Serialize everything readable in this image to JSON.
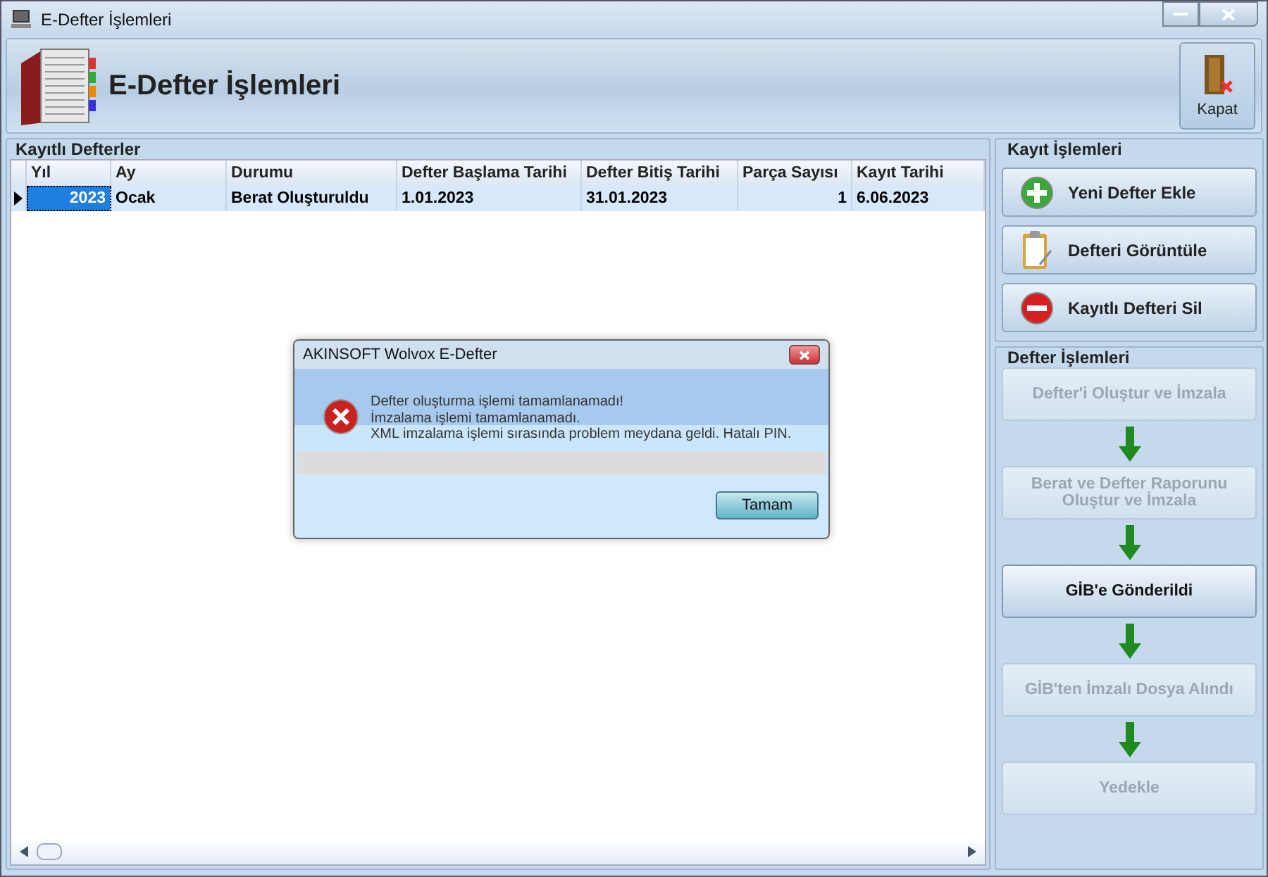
{
  "window": {
    "title": "E-Defter İşlemleri"
  },
  "header": {
    "title": "E-Defter İşlemleri",
    "close_label": "Kapat"
  },
  "table": {
    "group_title": "Kayıtlı Defterler",
    "columns": [
      {
        "label": "Yıl"
      },
      {
        "label": "Ay"
      },
      {
        "label": "Durumu"
      },
      {
        "label": "Defter Başlama Tarihi"
      },
      {
        "label": "Defter Bitiş Tarihi"
      },
      {
        "label": "Parça Sayısı"
      },
      {
        "label": "Kayıt Tarihi"
      }
    ],
    "rows": [
      {
        "selected": true,
        "cells": [
          "2023",
          "Ocak",
          "Berat Oluşturuldu",
          "1.01.2023",
          "31.01.2023",
          "1",
          "6.06.2023"
        ]
      }
    ]
  },
  "record_actions": {
    "title": "Kayıt İşlemleri",
    "buttons": [
      {
        "label": "Yeni Defter Ekle",
        "kind": "add"
      },
      {
        "label": "Defteri Görüntüle",
        "kind": "view"
      },
      {
        "label": "Kayıtlı Defteri Sil",
        "kind": "delete"
      }
    ]
  },
  "ledger_actions": {
    "title": "Defter İşlemleri",
    "steps": [
      {
        "label": "Defter'i Oluştur ve İmzala",
        "disabled": true
      },
      {
        "label": "Berat ve Defter Raporunu Oluştur ve İmzala",
        "disabled": true
      },
      {
        "label": "GİB'e Gönderildi",
        "disabled": false
      },
      {
        "label": "GİB'ten İmzalı Dosya Alındı",
        "disabled": true
      },
      {
        "label": "Yedekle",
        "disabled": true
      }
    ]
  },
  "dialog": {
    "title": "AKINSOFT Wolvox E-Defter",
    "message_lines": [
      "Defter oluşturma işlemi tamamlanamadı!",
      "İmzalama işlemi tamamlanamadı.",
      "XML imzalama işlemi sırasında problem meydana geldi. Hatalı PIN."
    ],
    "button": "Tamam"
  }
}
